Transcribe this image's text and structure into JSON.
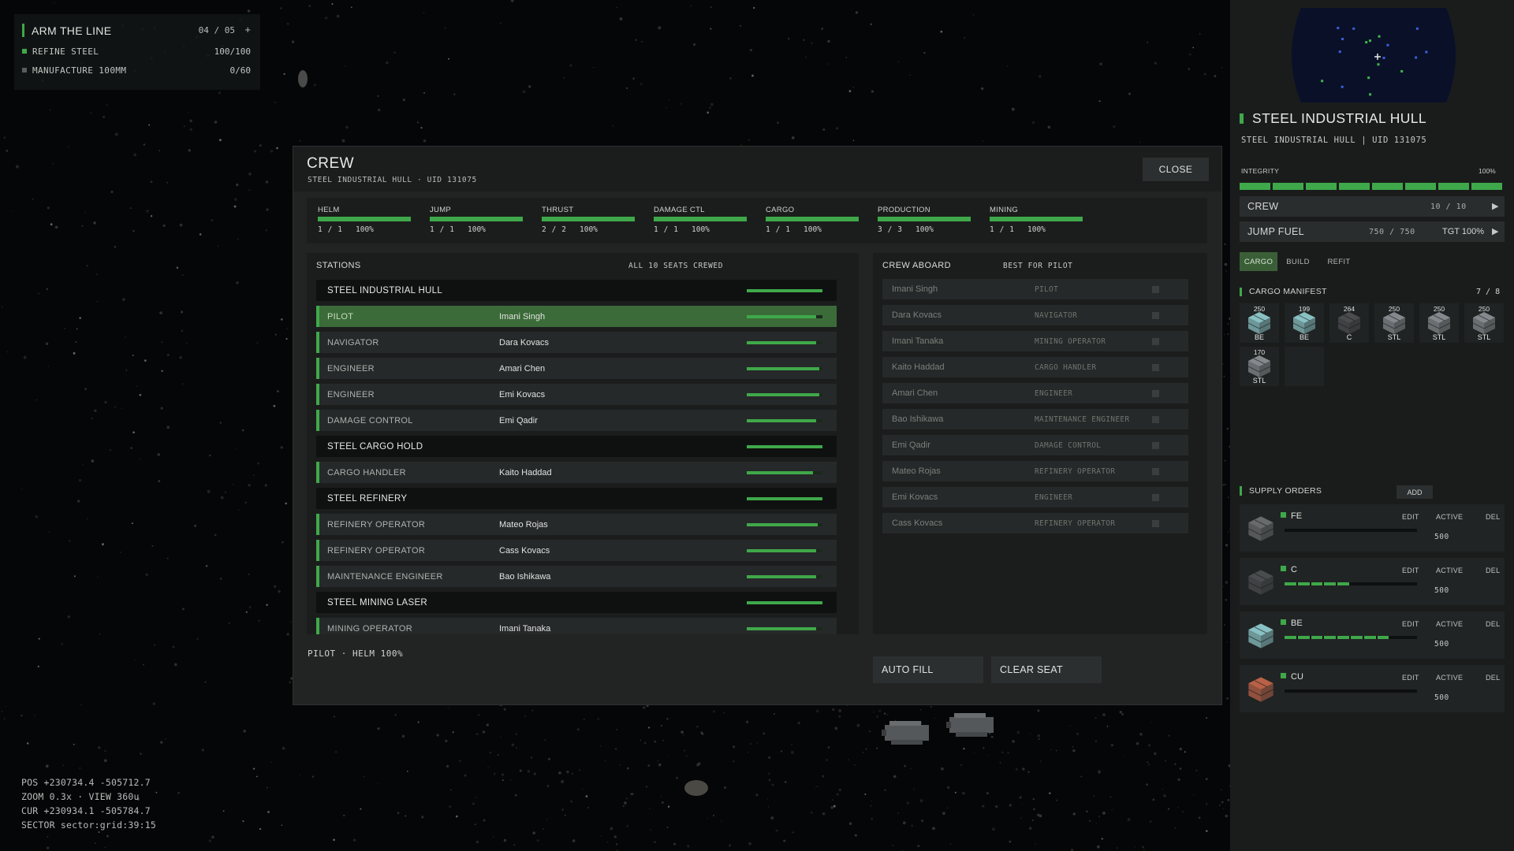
{
  "colors": {
    "accent": "#3fa84a",
    "panel": "#1b1d1d",
    "selected": "#3b6b38"
  },
  "quest": {
    "title": "ARM THE LINE",
    "progress": "04 / 05",
    "plus": "+",
    "objectives": [
      {
        "label": "REFINE STEEL",
        "value": "100/100",
        "done": true
      },
      {
        "label": "MANUFACTURE 100MM",
        "value": "0/60",
        "done": false
      }
    ]
  },
  "debug": {
    "pos": "POS +230734.4 -505712.7",
    "zoom": "ZOOM 0.3x · VIEW 360u",
    "cur": "CUR +230934.1 -505784.7",
    "sector": "SECTOR sector:grid:39:15"
  },
  "modal": {
    "title": "CREW",
    "subtitle": "STEEL INDUSTRIAL HULL · UID 131075",
    "close_label": "CLOSE",
    "stats": [
      {
        "name": "HELM",
        "value": "1 / 1",
        "pct": "100%",
        "fill": 1.0
      },
      {
        "name": "JUMP",
        "value": "1 / 1",
        "pct": "100%",
        "fill": 1.0
      },
      {
        "name": "THRUST",
        "value": "2 / 2",
        "pct": "100%",
        "fill": 1.0
      },
      {
        "name": "DAMAGE CTL",
        "value": "1 / 1",
        "pct": "100%",
        "fill": 1.0
      },
      {
        "name": "CARGO",
        "value": "1 / 1",
        "pct": "100%",
        "fill": 1.0
      },
      {
        "name": "PRODUCTION",
        "value": "3 / 3",
        "pct": "100%",
        "fill": 1.0
      },
      {
        "name": "MINING",
        "value": "1 / 1",
        "pct": "100%",
        "fill": 1.0
      }
    ],
    "stations_title": "STATIONS",
    "stations_status": "ALL 10 SEATS CREWED",
    "stations": [
      {
        "type": "group",
        "role": "STEEL INDUSTRIAL HULL",
        "crew": "",
        "fill": 1.0
      },
      {
        "type": "seat",
        "role": "PILOT",
        "crew": "Imani Singh",
        "fill": 0.92,
        "selected": true
      },
      {
        "type": "seat",
        "role": "NAVIGATOR",
        "crew": "Dara Kovacs",
        "fill": 0.92
      },
      {
        "type": "seat",
        "role": "ENGINEER",
        "crew": "Amari Chen",
        "fill": 0.96
      },
      {
        "type": "seat",
        "role": "ENGINEER",
        "crew": "Emi Kovacs",
        "fill": 0.96
      },
      {
        "type": "seat",
        "role": "DAMAGE CONTROL",
        "crew": "Emi Qadir",
        "fill": 0.92
      },
      {
        "type": "group",
        "role": "STEEL CARGO HOLD",
        "crew": "",
        "fill": 1.0
      },
      {
        "type": "seat",
        "role": "CARGO HANDLER",
        "crew": "Kaito Haddad",
        "fill": 0.88
      },
      {
        "type": "group",
        "role": "STEEL REFINERY",
        "crew": "",
        "fill": 1.0
      },
      {
        "type": "seat",
        "role": "REFINERY OPERATOR",
        "crew": "Mateo Rojas",
        "fill": 0.94
      },
      {
        "type": "seat",
        "role": "REFINERY OPERATOR",
        "crew": "Cass Kovacs",
        "fill": 0.92
      },
      {
        "type": "seat",
        "role": "MAINTENANCE ENGINEER",
        "crew": "Bao Ishikawa",
        "fill": 0.92
      },
      {
        "type": "group",
        "role": "STEEL MINING LASER",
        "crew": "",
        "fill": 1.0
      },
      {
        "type": "seat",
        "role": "MINING OPERATOR",
        "crew": "Imani Tanaka",
        "fill": 0.92
      }
    ],
    "crew_title": "CREW ABOARD",
    "crew_best": "BEST FOR PILOT",
    "crew": [
      {
        "name": "Imani Singh",
        "role": "PILOT"
      },
      {
        "name": "Dara Kovacs",
        "role": "NAVIGATOR"
      },
      {
        "name": "Imani Tanaka",
        "role": "MINING OPERATOR"
      },
      {
        "name": "Kaito Haddad",
        "role": "CARGO HANDLER"
      },
      {
        "name": "Amari Chen",
        "role": "ENGINEER"
      },
      {
        "name": "Bao Ishikawa",
        "role": "MAINTENANCE ENGINEER"
      },
      {
        "name": "Emi Qadir",
        "role": "DAMAGE CONTROL"
      },
      {
        "name": "Mateo Rojas",
        "role": "REFINERY OPERATOR"
      },
      {
        "name": "Emi Kovacs",
        "role": "ENGINEER"
      },
      {
        "name": "Cass Kovacs",
        "role": "REFINERY OPERATOR"
      }
    ],
    "footer_status": "PILOT · HELM 100%",
    "autofill_label": "AUTO FILL",
    "clearseat_label": "CLEAR SEAT"
  },
  "ship": {
    "title": "STEEL INDUSTRIAL HULL",
    "subtitle": "STEEL INDUSTRIAL HULL | UID 131075",
    "integrity_label": "INTEGRITY",
    "integrity_value": "100%",
    "integrity_fill": 1.0,
    "crew_label": "CREW",
    "crew_value": "10 / 10",
    "fuel_label": "JUMP FUEL",
    "fuel_value": "750 / 750",
    "fuel_target": "TGT 100%",
    "arrow": "▶",
    "tabs": [
      {
        "label": "CARGO",
        "active": true
      },
      {
        "label": "BUILD",
        "active": false
      },
      {
        "label": "REFIT",
        "active": false
      }
    ],
    "manifest_title": "CARGO MANIFEST",
    "manifest_count": "7 / 8",
    "cargo": [
      {
        "qty": "250",
        "code": "BE",
        "color": "#8fc9cc"
      },
      {
        "qty": "199",
        "code": "BE",
        "color": "#8fc9cc"
      },
      {
        "qty": "264",
        "code": "C",
        "color": "#4d4f52"
      },
      {
        "qty": "250",
        "code": "STL",
        "color": "#8b8f93"
      },
      {
        "qty": "250",
        "code": "STL",
        "color": "#8b8f93"
      },
      {
        "qty": "250",
        "code": "STL",
        "color": "#8b8f93"
      },
      {
        "qty": "170",
        "code": "STL",
        "color": "#8b8f93"
      }
    ],
    "supply_title": "SUPPLY ORDERS",
    "add_label": "ADD",
    "orders": [
      {
        "name": "FE",
        "qty": "500",
        "fill": 0.0,
        "color": "#6e6f72",
        "edit": "EDIT",
        "status": "ACTIVE",
        "del": "DEL"
      },
      {
        "name": "C",
        "qty": "500",
        "fill": 0.5,
        "color": "#4d4f52",
        "edit": "EDIT",
        "status": "ACTIVE",
        "del": "DEL"
      },
      {
        "name": "BE",
        "qty": "500",
        "fill": 0.8,
        "color": "#8fc9cc",
        "edit": "EDIT",
        "status": "ACTIVE",
        "del": "DEL"
      },
      {
        "name": "CU",
        "qty": "500",
        "fill": 0.0,
        "color": "#c2654a",
        "edit": "EDIT",
        "status": "ACTIVE",
        "del": "DEL"
      }
    ]
  }
}
